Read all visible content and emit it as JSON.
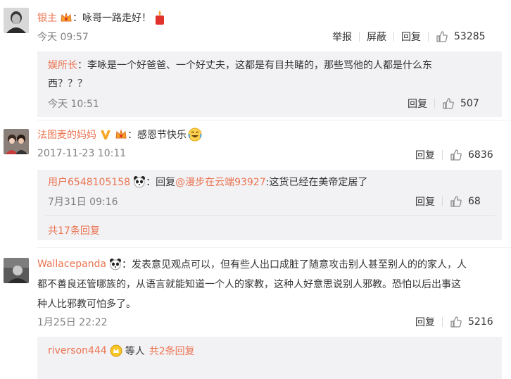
{
  "comments": [
    {
      "user": "银主",
      "text": "：咏哥一路走好！",
      "time": "今天 09:57",
      "actions": [
        "举报",
        "屏蔽",
        "回复"
      ],
      "likes": "53285",
      "reply": {
        "user": "娱所长",
        "text_line1": "：李咏是一个好爸爸、一个好丈夫，这都是有目共睹的，那些骂他的人都是什么东",
        "text_line2": "西？？？",
        "time": "今天 10:51",
        "action": "回复",
        "likes": "507"
      }
    },
    {
      "user": "法图麦的妈妈",
      "text": "：感恩节快乐",
      "time": "2017-11-23 10:11",
      "action": "回复",
      "likes": "6836",
      "reply": {
        "user": "用户6548105158",
        "mid": "：回复",
        "mention": "@漫步在云端93927",
        "text": ":这货已经在美帝定居了",
        "time": "7月31日 09:16",
        "action": "回复",
        "likes": "68"
      },
      "more": "共17条回复"
    },
    {
      "user": "Wallacepanda",
      "text_line1": "：发表意见观点可以，但有些人出口成脏了随意攻击别人甚至别人的的家人，人",
      "text_line2": "都不善良还管哪族的，从语言就能知道一个人的家教，这种人好意思说别人邪教。恐怕以后出事这",
      "text_line3": "种人比邪教可怕多了。",
      "time": "1月25日 22:22",
      "action": "回复",
      "likes": "5216",
      "summary": {
        "user": "riverson444",
        "mid": "等人",
        "more": "共2条回复"
      }
    }
  ],
  "colors": {
    "accent": "#eb7350",
    "reply_bg": "#f2f2f5",
    "muted": "#808080"
  },
  "icons": [
    "vip-badge-icon",
    "candle-emoji-icon",
    "v-badge-icon",
    "laugh-cry-emoji-icon",
    "panda-icon",
    "thumb-up-icon"
  ]
}
